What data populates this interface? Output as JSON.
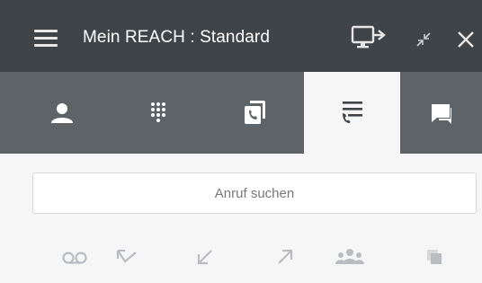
{
  "header": {
    "title": "Mein REACH : Standard",
    "icons": [
      "menu-icon",
      "monitor-transfer-icon",
      "minimize-icon",
      "close-icon"
    ]
  },
  "tabs": [
    {
      "icon": "person-icon",
      "active": false
    },
    {
      "icon": "dialpad-icon",
      "active": false
    },
    {
      "icon": "phone-copy-icon",
      "active": false
    },
    {
      "icon": "call-list-icon",
      "active": true
    },
    {
      "icon": "chat-icon",
      "active": false
    }
  ],
  "search": {
    "placeholder": "Anruf suchen"
  },
  "filters": [
    "voicemail-icon",
    "missed-call-icon",
    "incoming-call-icon",
    "outgoing-call-icon",
    "group-call-icon",
    "copy-icon"
  ],
  "colors": {
    "titlebar": "#3f4448",
    "tabbar": "#5d6367",
    "accent": "#3f4448",
    "filter_icon": "#b9bdc1"
  }
}
